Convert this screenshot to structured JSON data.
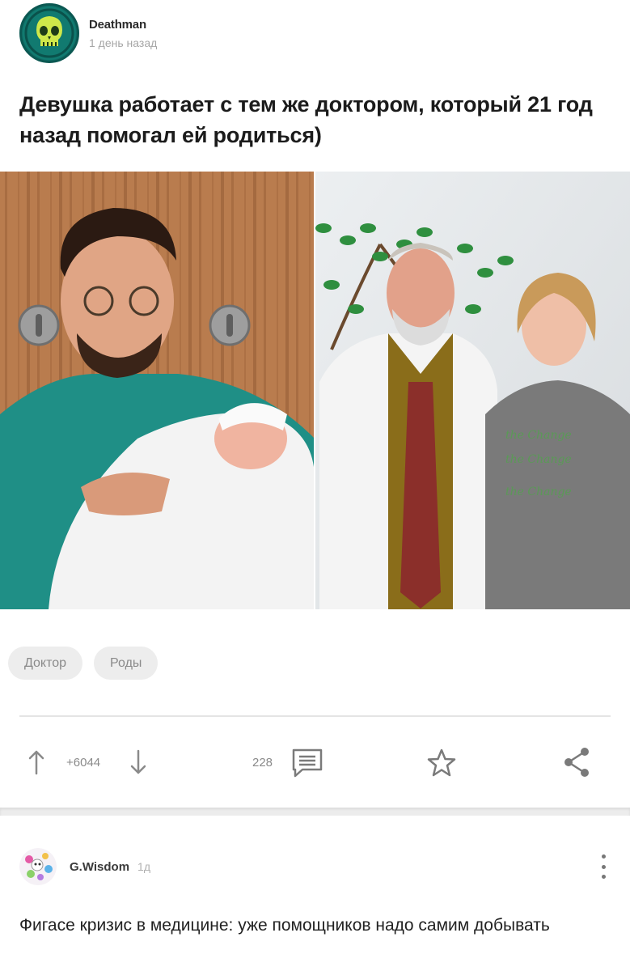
{
  "post": {
    "author": "Deathman",
    "time": "1 день назад",
    "title": "Девушка работает с тем же доктором, который 21 год назад помогал ей родиться)",
    "tags": [
      "Доктор",
      "Роды"
    ],
    "rating": "+6044",
    "comments_count": "228"
  },
  "icons": {
    "upvote": "arrow-up-icon",
    "downvote": "arrow-down-icon",
    "comments": "comments-icon",
    "save": "star-icon",
    "share": "share-icon",
    "more": "more-vertical-icon"
  },
  "comment": {
    "author": "G.Wisdom",
    "time": "1д",
    "text": "Фигасе кризис в медицине: уже помощников надо самим добывать"
  },
  "colors": {
    "avatar_bg": "#0f6e66",
    "icon_gray": "#8a8a8a",
    "tag_bg": "#ededed"
  }
}
